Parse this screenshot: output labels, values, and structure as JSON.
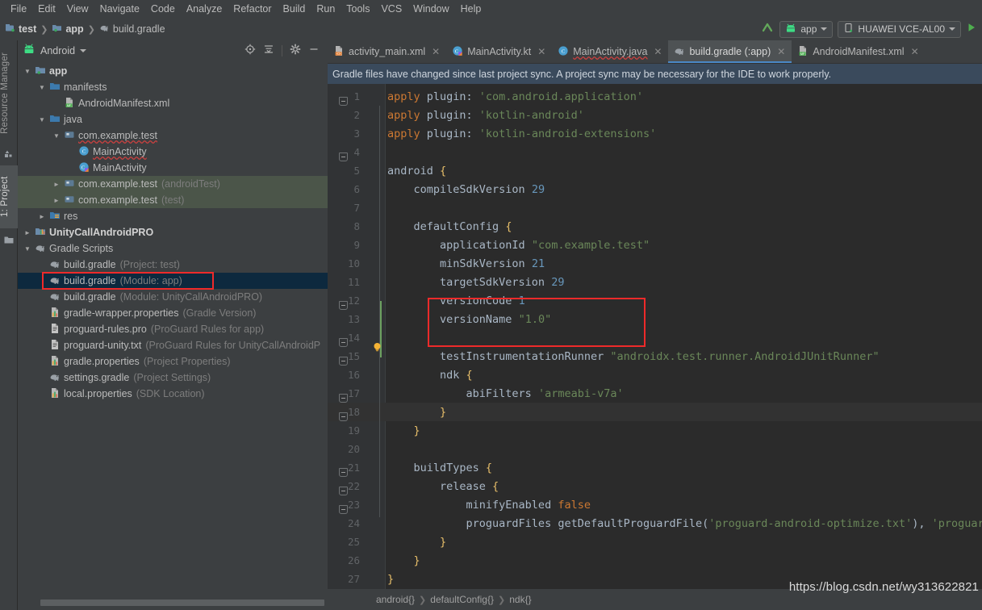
{
  "menubar": {
    "items": [
      "File",
      "Edit",
      "View",
      "Navigate",
      "Code",
      "Analyze",
      "Refactor",
      "Build",
      "Run",
      "Tools",
      "VCS",
      "Window",
      "Help"
    ]
  },
  "toolbar": {
    "breadcrumb": [
      "test",
      "app",
      "build.gradle"
    ],
    "run_config": "app",
    "device": "HUAWEI VCE-AL00",
    "run_icon": "run-play-icon",
    "sync_icon": "sync-arrow-icon"
  },
  "left_strip": {
    "resource_manager": "Resource Manager",
    "project": "1: Project"
  },
  "project_panel": {
    "title": "Android",
    "icons": [
      "target-locate-icon",
      "collapse-all-icon",
      "settings-gear-icon",
      "minimize-icon"
    ],
    "tree": [
      {
        "label": "app",
        "indent": 0,
        "twisty": "down",
        "icon": "module-folder-icon",
        "bold": true,
        "note": "",
        "state": ""
      },
      {
        "label": "manifests",
        "indent": 1,
        "twisty": "down",
        "icon": "folder-icon",
        "bold": false,
        "note": "",
        "state": ""
      },
      {
        "label": "AndroidManifest.xml",
        "indent": 2,
        "twisty": "",
        "icon": "manifest-file-icon",
        "bold": false,
        "note": "",
        "state": ""
      },
      {
        "label": "java",
        "indent": 1,
        "twisty": "down",
        "icon": "folder-icon",
        "bold": false,
        "note": "",
        "state": ""
      },
      {
        "label": "com.example.test",
        "indent": 2,
        "twisty": "down",
        "icon": "package-icon",
        "bold": false,
        "note": "",
        "state": "",
        "spell": true
      },
      {
        "label": "MainActivity",
        "indent": 3,
        "twisty": "",
        "icon": "java-class-icon",
        "bold": false,
        "note": "",
        "state": "",
        "spell": true
      },
      {
        "label": "MainActivity",
        "indent": 3,
        "twisty": "",
        "icon": "kotlin-class-icon",
        "bold": false,
        "note": "",
        "state": ""
      },
      {
        "label": "com.example.test",
        "indent": 2,
        "twisty": "right",
        "icon": "package-icon",
        "bold": false,
        "note": "(androidTest)",
        "state": "sel-green"
      },
      {
        "label": "com.example.test",
        "indent": 2,
        "twisty": "right",
        "icon": "package-icon",
        "bold": false,
        "note": "(test)",
        "state": "sel-green"
      },
      {
        "label": "res",
        "indent": 1,
        "twisty": "right",
        "icon": "res-folder-icon",
        "bold": false,
        "note": "",
        "state": ""
      },
      {
        "label": "UnityCallAndroidPRO",
        "indent": 0,
        "twisty": "right",
        "icon": "library-module-icon",
        "bold": true,
        "note": "",
        "state": ""
      },
      {
        "label": "Gradle Scripts",
        "indent": 0,
        "twisty": "down",
        "icon": "gradle-elephant-icon",
        "bold": false,
        "note": "",
        "state": ""
      },
      {
        "label": "build.gradle",
        "indent": 1,
        "twisty": "",
        "icon": "gradle-elephant-icon",
        "bold": false,
        "note": "(Project: test)",
        "state": ""
      },
      {
        "label": "build.gradle",
        "indent": 1,
        "twisty": "",
        "icon": "gradle-elephant-icon",
        "bold": false,
        "note": "(Module: app)",
        "state": "sel-blue",
        "highlight": true
      },
      {
        "label": "build.gradle",
        "indent": 1,
        "twisty": "",
        "icon": "gradle-elephant-icon",
        "bold": false,
        "note": "(Module: UnityCallAndroidPRO)",
        "state": ""
      },
      {
        "label": "gradle-wrapper.properties",
        "indent": 1,
        "twisty": "",
        "icon": "properties-file-icon",
        "bold": false,
        "note": "(Gradle Version)",
        "state": ""
      },
      {
        "label": "proguard-rules.pro",
        "indent": 1,
        "twisty": "",
        "icon": "text-file-icon",
        "bold": false,
        "note": "(ProGuard Rules for app)",
        "state": ""
      },
      {
        "label": "proguard-unity.txt",
        "indent": 1,
        "twisty": "",
        "icon": "text-file-icon",
        "bold": false,
        "note": "(ProGuard Rules for UnityCallAndroidP",
        "state": ""
      },
      {
        "label": "gradle.properties",
        "indent": 1,
        "twisty": "",
        "icon": "properties-file-icon",
        "bold": false,
        "note": "(Project Properties)",
        "state": ""
      },
      {
        "label": "settings.gradle",
        "indent": 1,
        "twisty": "",
        "icon": "gradle-elephant-icon",
        "bold": false,
        "note": "(Project Settings)",
        "state": ""
      },
      {
        "label": "local.properties",
        "indent": 1,
        "twisty": "",
        "icon": "properties-file-icon",
        "bold": false,
        "note": "(SDK Location)",
        "state": ""
      }
    ]
  },
  "editor": {
    "tabs": [
      {
        "label": "activity_main.xml",
        "icon": "android-layout-xml-icon",
        "active": false,
        "spell": false
      },
      {
        "label": "MainActivity.kt",
        "icon": "kotlin-class-icon",
        "active": false,
        "spell": false
      },
      {
        "label": "MainActivity.java",
        "icon": "java-class-icon",
        "active": false,
        "spell": true
      },
      {
        "label": "build.gradle (:app)",
        "icon": "gradle-elephant-icon",
        "active": true,
        "spell": false
      },
      {
        "label": "AndroidManifest.xml",
        "icon": "manifest-file-icon",
        "active": false,
        "spell": false
      }
    ],
    "banner": "Gradle files have changed since last project sync. A project sync may be necessary for the IDE to work properly.",
    "code_lines": [
      {
        "n": 1,
        "segments": [
          {
            "t": "apply",
            "c": "kw"
          },
          {
            "t": " plugin: ",
            "c": "plain"
          },
          {
            "t": "'com.android.application'",
            "c": "str"
          }
        ]
      },
      {
        "n": 2,
        "segments": [
          {
            "t": "apply",
            "c": "kw"
          },
          {
            "t": " plugin: ",
            "c": "plain"
          },
          {
            "t": "'kotlin-android'",
            "c": "str"
          }
        ]
      },
      {
        "n": 3,
        "segments": [
          {
            "t": "apply",
            "c": "kw"
          },
          {
            "t": " plugin: ",
            "c": "plain"
          },
          {
            "t": "'kotlin-android-extensions'",
            "c": "str"
          }
        ]
      },
      {
        "n": 4,
        "segments": []
      },
      {
        "n": 5,
        "segments": [
          {
            "t": "android ",
            "c": "plain"
          },
          {
            "t": "{",
            "c": "brc"
          }
        ]
      },
      {
        "n": 6,
        "segments": [
          {
            "t": "    compileSdkVersion ",
            "c": "plain"
          },
          {
            "t": "29",
            "c": "num2"
          }
        ]
      },
      {
        "n": 7,
        "segments": []
      },
      {
        "n": 8,
        "segments": [
          {
            "t": "    defaultConfig ",
            "c": "plain"
          },
          {
            "t": "{",
            "c": "brc"
          }
        ]
      },
      {
        "n": 9,
        "segments": [
          {
            "t": "        applicationId ",
            "c": "plain"
          },
          {
            "t": "\"com.example.test\"",
            "c": "str"
          }
        ]
      },
      {
        "n": 10,
        "segments": [
          {
            "t": "        minSdkVersion ",
            "c": "plain"
          },
          {
            "t": "21",
            "c": "num2"
          }
        ]
      },
      {
        "n": 11,
        "segments": [
          {
            "t": "        targetSdkVersion ",
            "c": "plain"
          },
          {
            "t": "29",
            "c": "num2"
          }
        ]
      },
      {
        "n": 12,
        "segments": [
          {
            "t": "        versionCode ",
            "c": "plain"
          },
          {
            "t": "1",
            "c": "num2"
          }
        ]
      },
      {
        "n": 13,
        "segments": [
          {
            "t": "        versionName ",
            "c": "plain"
          },
          {
            "t": "\"1.0\"",
            "c": "str"
          }
        ]
      },
      {
        "n": 14,
        "segments": []
      },
      {
        "n": 15,
        "segments": [
          {
            "t": "        testInstrumentationRunner ",
            "c": "plain"
          },
          {
            "t": "\"androidx.test.runner.AndroidJUnitRunner\"",
            "c": "str"
          }
        ]
      },
      {
        "n": 16,
        "segments": [
          {
            "t": "        ndk ",
            "c": "plain"
          },
          {
            "t": "{",
            "c": "brc"
          }
        ]
      },
      {
        "n": 17,
        "segments": [
          {
            "t": "            abiFilters ",
            "c": "plain"
          },
          {
            "t": "'armeabi-v7a'",
            "c": "str"
          }
        ]
      },
      {
        "n": 18,
        "segments": [
          {
            "t": "        ",
            "c": "plain"
          },
          {
            "t": "}",
            "c": "brc"
          }
        ]
      },
      {
        "n": 19,
        "segments": [
          {
            "t": "    ",
            "c": "plain"
          },
          {
            "t": "}",
            "c": "brc"
          }
        ]
      },
      {
        "n": 20,
        "segments": []
      },
      {
        "n": 21,
        "segments": [
          {
            "t": "    buildTypes ",
            "c": "plain"
          },
          {
            "t": "{",
            "c": "brc"
          }
        ]
      },
      {
        "n": 22,
        "segments": [
          {
            "t": "        release ",
            "c": "plain"
          },
          {
            "t": "{",
            "c": "brc"
          }
        ]
      },
      {
        "n": 23,
        "segments": [
          {
            "t": "            minifyEnabled ",
            "c": "plain"
          },
          {
            "t": "false",
            "c": "kw"
          }
        ]
      },
      {
        "n": 24,
        "segments": [
          {
            "t": "            proguardFiles getDefaultProguardFile(",
            "c": "plain"
          },
          {
            "t": "'proguard-android-optimize.txt'",
            "c": "str"
          },
          {
            "t": "), ",
            "c": "plain"
          },
          {
            "t": "'proguard-",
            "c": "str"
          }
        ]
      },
      {
        "n": 25,
        "segments": [
          {
            "t": "        ",
            "c": "plain"
          },
          {
            "t": "}",
            "c": "brc"
          }
        ]
      },
      {
        "n": 26,
        "segments": [
          {
            "t": "    ",
            "c": "plain"
          },
          {
            "t": "}",
            "c": "brc"
          }
        ]
      },
      {
        "n": 27,
        "segments": [
          {
            "t": "}",
            "c": "brc"
          }
        ]
      }
    ],
    "current_line": 18,
    "status_breadcrumb": [
      "android{}",
      "defaultConfig{}",
      "ndk{}"
    ],
    "watermark": "https://blog.csdn.net/wy313622821"
  },
  "colors": {
    "accent_tab": "#4a88c7",
    "highlight_box": "#ee2a2a",
    "selection_blue": "#0d293e",
    "selection_green": "#4b5549",
    "banner_bg": "#3a4a5c",
    "editor_bg": "#2b2b2b",
    "panel_bg": "#3c3f41"
  }
}
